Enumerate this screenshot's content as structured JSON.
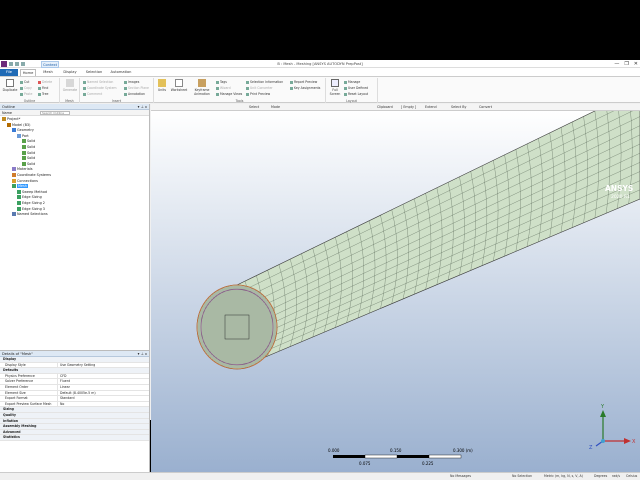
{
  "window": {
    "title": "B : Mesh - Meshing [ANSYS AUTODYN PrepPost]",
    "context_tab": "Context",
    "search_placeholder": "Quick Launch",
    "controls": [
      "—",
      "❐",
      "✕"
    ]
  },
  "ribbon_tabs": [
    "File",
    "Home",
    "Mesh",
    "Display",
    "Selection",
    "Automation"
  ],
  "ribbon": {
    "groups": [
      "Outline",
      "Mesh",
      "Insert",
      "Tools",
      "Layout"
    ],
    "outline": {
      "duplicate": "Duplicate",
      "small": [
        "Cut",
        "Copy",
        "Paste",
        "Delete",
        "Find",
        "Tree"
      ]
    },
    "mesh": {
      "generate": "Generate"
    },
    "insert": {
      "small": [
        "Named Selection",
        "Coordinate System",
        "Comment",
        "Images",
        "Section Plane",
        "Annotation"
      ]
    },
    "tools": {
      "big": [
        "Units",
        "Worksheet",
        "Keyframe Animation"
      ],
      "small": [
        "Tags",
        "Wizard",
        "Manage Views",
        "Selection Information",
        "Unit Converter",
        "Print Preview",
        "Report Preview",
        "Key Assignments"
      ]
    },
    "layout": {
      "big": "Full Screen",
      "small": [
        "Manage",
        "User Defined",
        "Reset Layout"
      ]
    }
  },
  "outline": {
    "title": "Outline",
    "pin": "▾ ⊥ x",
    "filter_label": "Name",
    "search_placeholder": "Search Outline",
    "tree": [
      {
        "label": "Project*",
        "level": 0,
        "icon": "project-icon",
        "color": "#c08a20"
      },
      {
        "label": "Model (B3)",
        "level": 1,
        "icon": "model-icon",
        "color": "#b36b00"
      },
      {
        "label": "Geometry",
        "level": 2,
        "icon": "geometry-icon",
        "color": "#3a7bd5"
      },
      {
        "label": "Part",
        "level": 3,
        "icon": "part-icon",
        "color": "#6a9ad8"
      },
      {
        "label": "Solid",
        "level": 4,
        "icon": "solid-icon",
        "color": "#5aa14a"
      },
      {
        "label": "Solid",
        "level": 4,
        "icon": "solid-icon",
        "color": "#5aa14a"
      },
      {
        "label": "Solid",
        "level": 4,
        "icon": "solid-icon",
        "color": "#5aa14a"
      },
      {
        "label": "Solid",
        "level": 4,
        "icon": "solid-icon",
        "color": "#5aa14a"
      },
      {
        "label": "Solid",
        "level": 4,
        "icon": "solid-icon",
        "color": "#5aa14a"
      },
      {
        "label": "Materials",
        "level": 2,
        "icon": "materials-icon",
        "color": "#8a7bc8"
      },
      {
        "label": "Coordinate Systems",
        "level": 2,
        "icon": "coordinate-icon",
        "color": "#d07b2a"
      },
      {
        "label": "Connections",
        "level": 2,
        "icon": "connections-icon",
        "color": "#d8a030"
      },
      {
        "label": "Mesh",
        "level": 2,
        "icon": "mesh-icon",
        "color": "#3aa060",
        "selected": true
      },
      {
        "label": "Sweep Method",
        "level": 3,
        "icon": "sweep-icon",
        "color": "#3aa060"
      },
      {
        "label": "Edge Sizing",
        "level": 3,
        "icon": "sizing-icon",
        "color": "#3aa060"
      },
      {
        "label": "Edge Sizing 2",
        "level": 3,
        "icon": "sizing-icon",
        "color": "#3aa060"
      },
      {
        "label": "Edge Sizing 3",
        "level": 3,
        "icon": "sizing-icon",
        "color": "#3aa060"
      },
      {
        "label": "Named Selections",
        "level": 2,
        "icon": "named-selection-icon",
        "color": "#5a7ab0"
      }
    ]
  },
  "details": {
    "title": "Details of \"Mesh\"",
    "rows": [
      {
        "type": "section",
        "key": "Display"
      },
      {
        "key": "Display Style",
        "value": "Use Geometry Setting"
      },
      {
        "type": "section",
        "key": "Defaults"
      },
      {
        "key": "Physics Preference",
        "value": "CFD"
      },
      {
        "key": "Solver Preference",
        "value": "Fluent"
      },
      {
        "key": "Element Order",
        "value": "Linear"
      },
      {
        "key": "Element Size",
        "value": "Default (8.4005e-5 m)"
      },
      {
        "key": "Export Format",
        "value": "Standard"
      },
      {
        "key": "Export Preview Surface Mesh",
        "value": "No"
      },
      {
        "type": "section",
        "key": "Sizing"
      },
      {
        "type": "section",
        "key": "Quality"
      },
      {
        "type": "section",
        "key": "Inflation"
      },
      {
        "type": "section",
        "key": "Assembly Meshing"
      },
      {
        "type": "section",
        "key": "Advanced"
      },
      {
        "type": "section",
        "key": "Statistics"
      }
    ]
  },
  "viewport_toolbar": [
    "Select",
    "Mode",
    "Clipboard",
    "[ Empty ]",
    "Extend",
    "Select By",
    "Convert"
  ],
  "viewport": {
    "logo_line1": "ANSYS",
    "logo_line2": "2020 R1",
    "scale": {
      "labels": [
        "0.000",
        "0.150",
        "0.300 (m)"
      ],
      "sublabels": [
        "0.075",
        "0.225"
      ]
    },
    "axes": {
      "y": "Y",
      "z": "Z",
      "x": "X"
    },
    "mesh_face_color": "#cfe0c8",
    "background_top": "#ffffff",
    "background_bottom": "#9ab0cf"
  },
  "statusbar": {
    "messages": "No Messages",
    "selection": "No Selection",
    "units": "Metric (m, kg, N, s, V, A)",
    "angle": "Degrees",
    "rate": "rad/s",
    "temp": "Celsius"
  }
}
